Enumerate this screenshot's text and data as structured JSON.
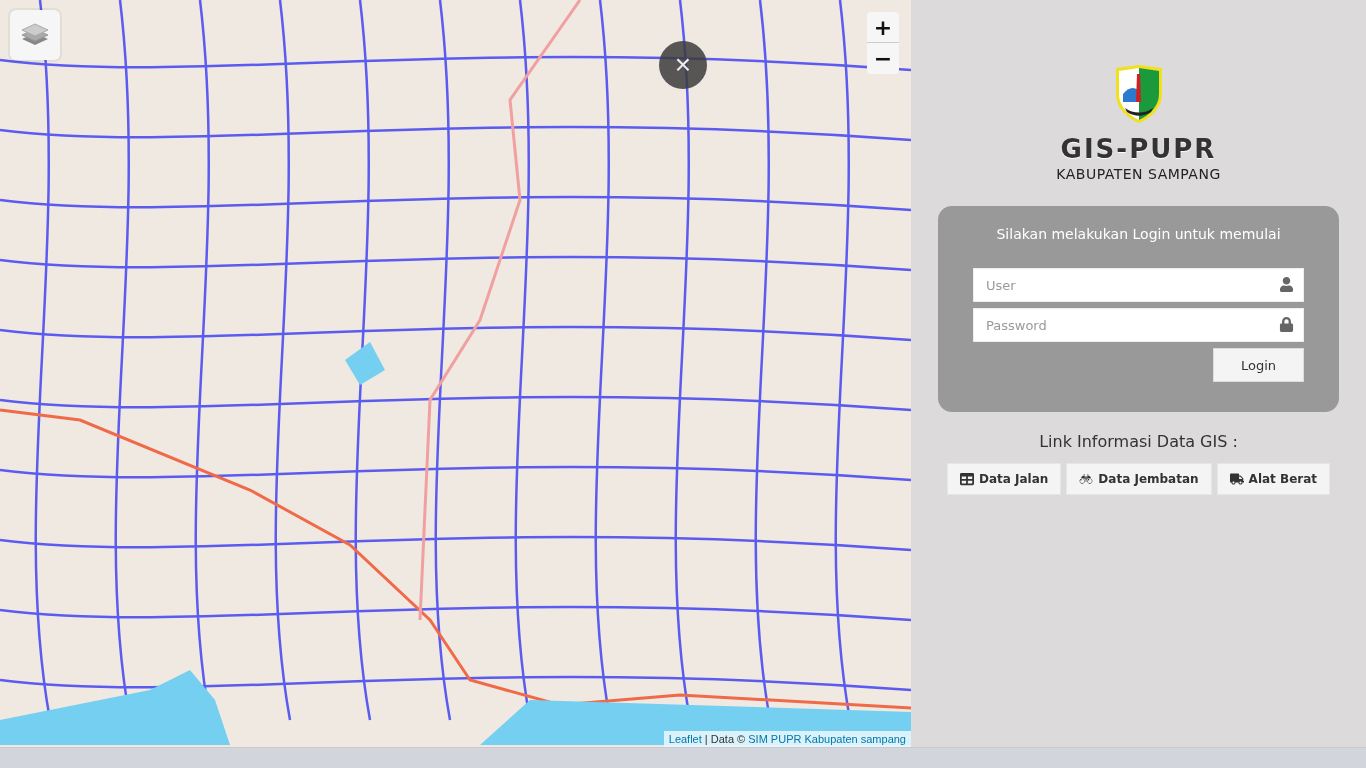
{
  "map": {
    "zoom_in": "+",
    "zoom_out": "−",
    "close": "×",
    "attribution": {
      "first_link": "Leaflet",
      "middle": " | Data © ",
      "second_link": "SIM PUPR Kabupaten sampang"
    }
  },
  "brand": {
    "title": "GIS-PUPR",
    "subtitle": "KABUPATEN SAMPANG"
  },
  "login": {
    "heading": "Silakan melakukan Login untuk memulai",
    "fields": [
      {
        "kind": "user",
        "placeholder": "User"
      },
      {
        "kind": "password",
        "placeholder": "Password"
      }
    ],
    "button": "Login"
  },
  "links": {
    "heading": "Link Informasi Data GIS :",
    "buttons": [
      {
        "kind": "table",
        "label": "Data Jalan"
      },
      {
        "kind": "binoculars",
        "label": "Data Jembatan"
      },
      {
        "kind": "truck",
        "label": "Alat Berat"
      }
    ]
  }
}
